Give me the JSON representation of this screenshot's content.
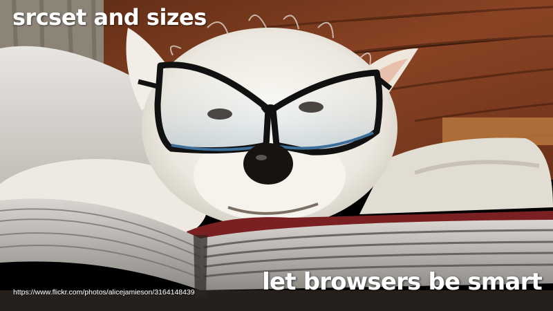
{
  "slide": {
    "title": "srcset and sizes",
    "tagline": "let browsers be smart",
    "credit": "https://www.flickr.com/photos/alicejamieson/3164148439"
  },
  "photo": {
    "subject": "white-terrier-with-glasses-on-book",
    "colors": {
      "wood": "#7a3c1f",
      "fur": "#f3efe6",
      "glasses_frame": "#111111",
      "glasses_lens_edge": "#3e6f9a",
      "book_cover": "#7a1f22"
    }
  }
}
